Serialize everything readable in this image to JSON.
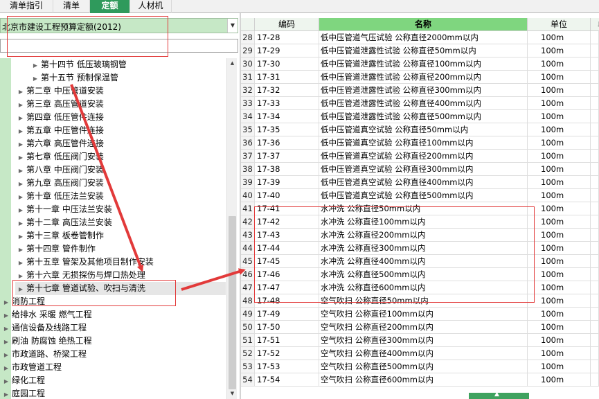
{
  "tabs": [
    {
      "label": "清单指引",
      "active": false
    },
    {
      "label": "清单",
      "active": false
    },
    {
      "label": "定额",
      "active": true
    },
    {
      "label": "人材机",
      "active": false
    }
  ],
  "quota_selector": {
    "value": "北京市建设工程预算定额(2012)"
  },
  "search": {
    "value": ""
  },
  "tree": [
    {
      "label": "第十四节 低压玻璃钢管",
      "level": 2,
      "has_children": true
    },
    {
      "label": "第十五节 预制保温管",
      "level": 2,
      "has_children": true
    },
    {
      "label": "第二章 中压管道安装",
      "level": 1,
      "has_children": true
    },
    {
      "label": "第三章 高压管道安装",
      "level": 1,
      "has_children": true
    },
    {
      "label": "第四章 低压管件连接",
      "level": 1,
      "has_children": true
    },
    {
      "label": "第五章 中压管件连接",
      "level": 1,
      "has_children": true
    },
    {
      "label": "第六章 高压管件连接",
      "level": 1,
      "has_children": true
    },
    {
      "label": "第七章 低压阀门安装",
      "level": 1,
      "has_children": true
    },
    {
      "label": "第八章 中压阀门安装",
      "level": 1,
      "has_children": true
    },
    {
      "label": "第九章 高压阀门安装",
      "level": 1,
      "has_children": true
    },
    {
      "label": "第十章 低压法兰安装",
      "level": 1,
      "has_children": true
    },
    {
      "label": "第十一章 中压法兰安装",
      "level": 1,
      "has_children": true
    },
    {
      "label": "第十二章 高压法兰安装",
      "level": 1,
      "has_children": true
    },
    {
      "label": "第十三章 板卷管制作",
      "level": 1,
      "has_children": true
    },
    {
      "label": "第十四章 管件制作",
      "level": 1,
      "has_children": true
    },
    {
      "label": "第十五章 管架及其他项目制作安装",
      "level": 1,
      "has_children": true
    },
    {
      "label": "第十六章 无损探伤与焊口热处理",
      "level": 1,
      "has_children": true
    },
    {
      "label": "第十七章 管道试验、吹扫与清洗",
      "level": 1,
      "has_children": true,
      "selected": true
    },
    {
      "label": "消防工程",
      "level": 0,
      "has_children": true
    },
    {
      "label": "给排水 采暖 燃气工程",
      "level": 0,
      "has_children": true
    },
    {
      "label": "通信设备及线路工程",
      "level": 0,
      "has_children": true
    },
    {
      "label": "刷油 防腐蚀 绝热工程",
      "level": 0,
      "has_children": true
    },
    {
      "label": "市政道路、桥梁工程",
      "level": 0,
      "has_children": true
    },
    {
      "label": "市政管道工程",
      "level": 0,
      "has_children": true
    },
    {
      "label": "绿化工程",
      "level": 0,
      "has_children": true
    },
    {
      "label": "庭园工程",
      "level": 0,
      "has_children": true
    }
  ],
  "table": {
    "headers": {
      "num": "",
      "code": "编码",
      "name": "名称",
      "unit": "单位",
      "extra": "单"
    },
    "rows": [
      {
        "num": "28",
        "code": "17-28",
        "name": "低中压管道气压试验 公称直径2000mm以内",
        "unit": "100m"
      },
      {
        "num": "29",
        "code": "17-29",
        "name": "低中压管道泄露性试验 公称直径50mm以内",
        "unit": "100m"
      },
      {
        "num": "30",
        "code": "17-30",
        "name": "低中压管道泄露性试验 公称直径100mm以内",
        "unit": "100m"
      },
      {
        "num": "31",
        "code": "17-31",
        "name": "低中压管道泄露性试验 公称直径200mm以内",
        "unit": "100m"
      },
      {
        "num": "32",
        "code": "17-32",
        "name": "低中压管道泄露性试验 公称直径300mm以内",
        "unit": "100m"
      },
      {
        "num": "33",
        "code": "17-33",
        "name": "低中压管道泄露性试验 公称直径400mm以内",
        "unit": "100m"
      },
      {
        "num": "34",
        "code": "17-34",
        "name": "低中压管道泄露性试验 公称直径500mm以内",
        "unit": "100m"
      },
      {
        "num": "35",
        "code": "17-35",
        "name": "低中压管道真空试验 公称直径50mm以内",
        "unit": "100m"
      },
      {
        "num": "36",
        "code": "17-36",
        "name": "低中压管道真空试验 公称直径100mm以内",
        "unit": "100m"
      },
      {
        "num": "37",
        "code": "17-37",
        "name": "低中压管道真空试验 公称直径200mm以内",
        "unit": "100m"
      },
      {
        "num": "38",
        "code": "17-38",
        "name": "低中压管道真空试验 公称直径300mm以内",
        "unit": "100m"
      },
      {
        "num": "39",
        "code": "17-39",
        "name": "低中压管道真空试验 公称直径400mm以内",
        "unit": "100m"
      },
      {
        "num": "40",
        "code": "17-40",
        "name": "低中压管道真空试验 公称直径500mm以内",
        "unit": "100m"
      },
      {
        "num": "41",
        "code": "17-41",
        "name": "水冲洗 公称直径50mm以内",
        "unit": "100m"
      },
      {
        "num": "42",
        "code": "17-42",
        "name": "水冲洗 公称直径100mm以内",
        "unit": "100m"
      },
      {
        "num": "43",
        "code": "17-43",
        "name": "水冲洗 公称直径200mm以内",
        "unit": "100m"
      },
      {
        "num": "44",
        "code": "17-44",
        "name": "水冲洗 公称直径300mm以内",
        "unit": "100m"
      },
      {
        "num": "45",
        "code": "17-45",
        "name": "水冲洗 公称直径400mm以内",
        "unit": "100m"
      },
      {
        "num": "46",
        "code": "17-46",
        "name": "水冲洗 公称直径500mm以内",
        "unit": "100m"
      },
      {
        "num": "47",
        "code": "17-47",
        "name": "水冲洗 公称直径600mm以内",
        "unit": "100m"
      },
      {
        "num": "48",
        "code": "17-48",
        "name": "空气吹扫 公称直径50mm以内",
        "unit": "100m"
      },
      {
        "num": "49",
        "code": "17-49",
        "name": "空气吹扫 公称直径100mm以内",
        "unit": "100m"
      },
      {
        "num": "50",
        "code": "17-50",
        "name": "空气吹扫 公称直径200mm以内",
        "unit": "100m"
      },
      {
        "num": "51",
        "code": "17-51",
        "name": "空气吹扫 公称直径300mm以内",
        "unit": "100m"
      },
      {
        "num": "52",
        "code": "17-52",
        "name": "空气吹扫 公称直径400mm以内",
        "unit": "100m"
      },
      {
        "num": "53",
        "code": "17-53",
        "name": "空气吹扫 公称直径500mm以内",
        "unit": "100m"
      },
      {
        "num": "54",
        "code": "17-54",
        "name": "空气吹扫 公称直径600mm以内",
        "unit": "100m"
      }
    ]
  },
  "colors": {
    "active_tab": "#2f9a5c",
    "selected_header": "#7fd67f",
    "tree_highlight": "#c6e8c6",
    "annotation": "#e23a3a"
  }
}
